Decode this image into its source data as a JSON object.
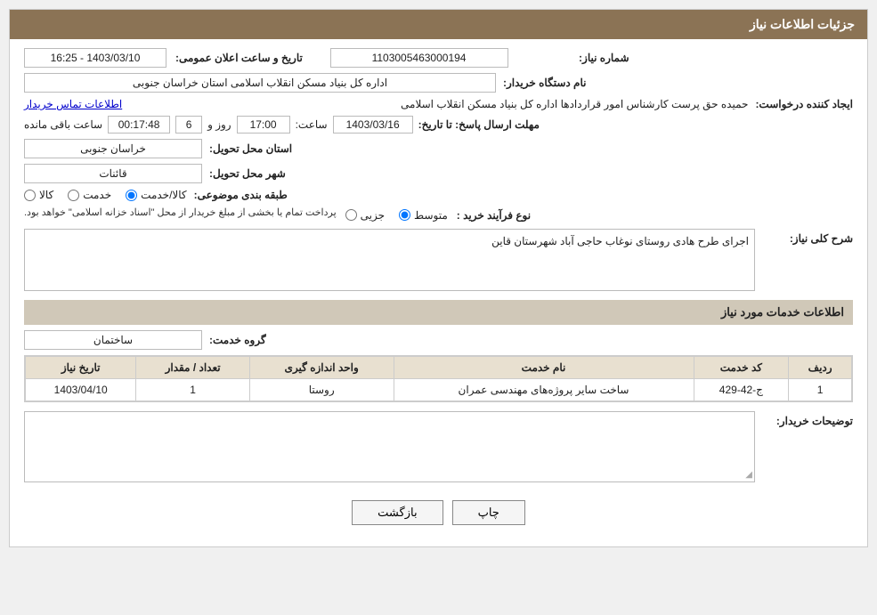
{
  "page": {
    "title": "جزئیات اطلاعات نیاز",
    "sections": {
      "need_info": "جزئیات اطلاعات نیاز",
      "service_info": "اطلاعات خدمات مورد نیاز"
    }
  },
  "fields": {
    "need_number_label": "شماره نیاز:",
    "need_number_value": "1103005463000194",
    "buyer_org_label": "نام دستگاه خریدار:",
    "buyer_org_value": "اداره کل بنیاد مسکن انقلاب اسلامی استان خراسان جنوبی",
    "creator_label": "ایجاد کننده درخواست:",
    "creator_value": "حمیده حق پرست کارشناس امور قراردادها اداره کل بنیاد مسکن انقلاب اسلامی",
    "contact_link": "اطلاعات تماس خریدار",
    "deadline_label": "مهلت ارسال پاسخ: تا تاریخ:",
    "deadline_date": "1403/03/16",
    "deadline_time_label": "ساعت:",
    "deadline_time": "17:00",
    "deadline_days_label": "روز و",
    "deadline_days": "6",
    "deadline_remaining_label": "ساعت باقی مانده",
    "deadline_remaining": "00:17:48",
    "announce_label": "تاریخ و ساعت اعلان عمومی:",
    "announce_value": "1403/03/10 - 16:25",
    "province_label": "استان محل تحویل:",
    "province_value": "خراسان جنوبی",
    "city_label": "شهر محل تحویل:",
    "city_value": "قائنات",
    "category_label": "طبقه بندی موضوعی:",
    "category_radio": [
      "کالا",
      "خدمت",
      "کالا/خدمت"
    ],
    "category_selected": "کالا/خدمت",
    "purchase_type_label": "نوع فرآیند خرید :",
    "purchase_types": [
      "جزیی",
      "متوسط"
    ],
    "purchase_note": "پرداخت تمام یا بخشی از مبلغ خریدار از محل \"اسناد خزانه اسلامی\" خواهد بود.",
    "need_description_label": "شرح کلی نیاز:",
    "need_description_value": "اجرای طرح هادی روستای نوغاب حاجی آباد شهرستان قاین",
    "service_group_label": "گروه خدمت:",
    "service_group_value": "ساختمان",
    "table": {
      "headers": [
        "ردیف",
        "کد خدمت",
        "نام خدمت",
        "واحد اندازه گیری",
        "تعداد / مقدار",
        "تاریخ نیاز"
      ],
      "rows": [
        {
          "row": "1",
          "service_code": "ج-42-429",
          "service_name": "ساخت سایر پروژه‌های مهندسی عمران",
          "unit": "روستا",
          "quantity": "1",
          "date": "1403/04/10"
        }
      ]
    },
    "buyer_notes_label": "توضیحات خریدار:",
    "buyer_notes_value": ""
  },
  "buttons": {
    "print": "چاپ",
    "back": "بازگشت"
  }
}
